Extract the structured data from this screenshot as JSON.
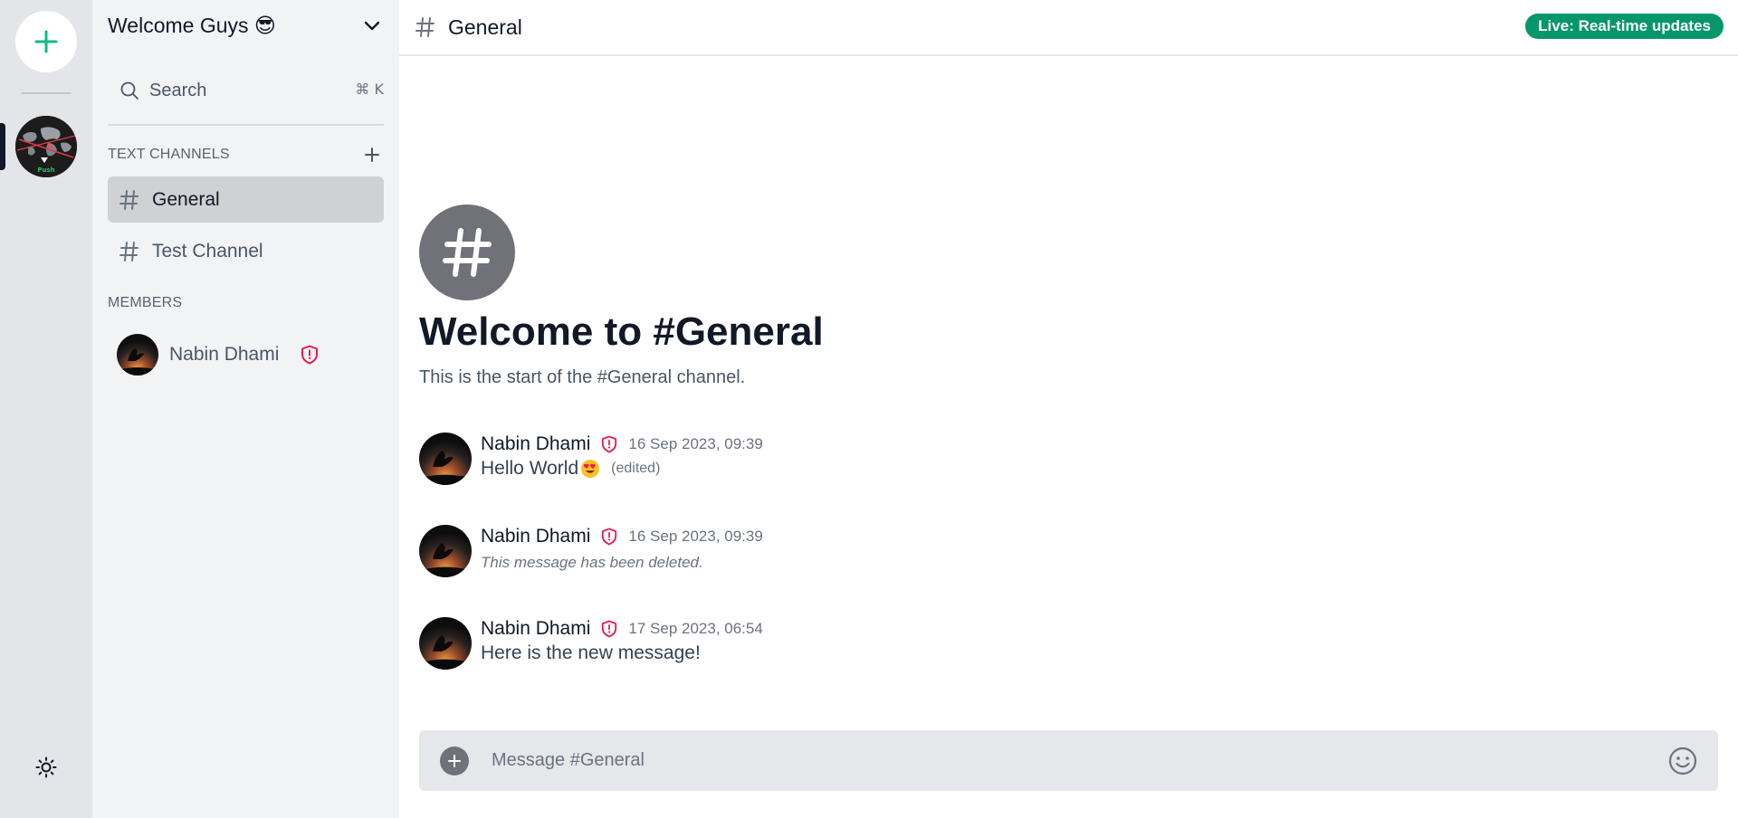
{
  "rail": {
    "add_icon": "plus-icon",
    "server_image": "globe-map-image",
    "server_image_text": "Push",
    "theme_icon": "sun-icon"
  },
  "sidebar": {
    "server_name": "Welcome Guys 😎",
    "search": {
      "label": "Search",
      "shortcut": "⌘ K"
    },
    "text_channels_label": "TEXT CHANNELS",
    "channels": [
      {
        "label": "General",
        "active": true
      },
      {
        "label": "Test Channel",
        "active": false
      }
    ],
    "members_label": "MEMBERS",
    "members": [
      {
        "name": "Nabin Dhami",
        "role_icon": "shield-alert-icon"
      }
    ]
  },
  "header": {
    "channel_title": "General",
    "live_badge": "Live: Real-time updates"
  },
  "welcome": {
    "title": "Welcome to #General",
    "subtitle": "This is the start of the #General channel."
  },
  "messages": [
    {
      "author": "Nabin Dhami",
      "timestamp": "16 Sep 2023, 09:39",
      "text": "Hello World",
      "emoji": "heart-eyes-emoji",
      "edited_label": "(edited)"
    },
    {
      "author": "Nabin Dhami",
      "timestamp": "16 Sep 2023, 09:39",
      "deleted_text": "This message has been deleted."
    },
    {
      "author": "Nabin Dhami",
      "timestamp": "17 Sep 2023, 06:54",
      "text": "Here is the new message!"
    }
  ],
  "composer": {
    "placeholder": "Message #General"
  },
  "colors": {
    "accent_green": "#10b981",
    "live_badge": "#059669",
    "admin_badge": "#e11d48",
    "channel_active_bg": "#cfd1d4"
  }
}
